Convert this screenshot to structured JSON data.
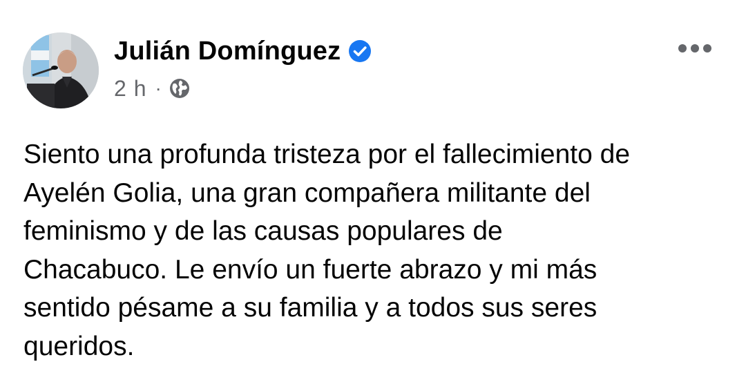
{
  "post": {
    "author": {
      "name": "Julián Domínguez",
      "verified": true,
      "verified_icon": "verified-badge-icon",
      "avatar_icon": "profile-photo"
    },
    "timestamp": "2 h",
    "separator": "·",
    "audience_icon": "globe-icon",
    "more_icon": "more-options-icon",
    "text": "Siento una profunda tristeza por el fallecimiento de\nAyelén Golia, una gran compañera militante del\nfeminismo y de las causas populares de\nChacabuco. Le envío un fuerte abrazo y mi más\nsentido pésame a su familia y a todos sus seres\nqueridos."
  },
  "colors": {
    "text_primary": "#050505",
    "text_secondary": "#65676b",
    "verified_blue": "#1877f2",
    "background": "#ffffff"
  }
}
